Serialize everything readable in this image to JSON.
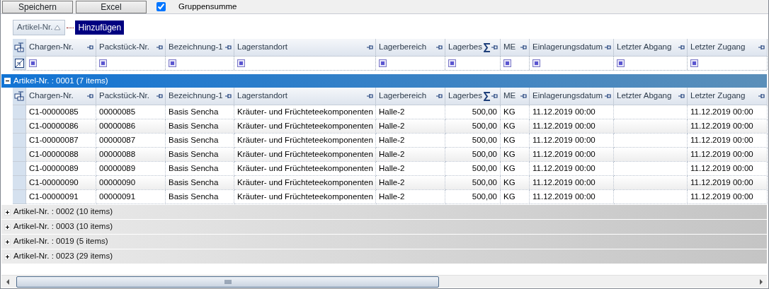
{
  "toolbar": {
    "buttons": [
      "Speichern",
      "Excel"
    ],
    "checkbox": {
      "label": "Gruppensumme",
      "checked": true
    }
  },
  "group_panel": {
    "group_by": {
      "label": "Artikel-Nr.",
      "ascending": true
    },
    "add_button": "Hinzufügen"
  },
  "columns": [
    {
      "label": "Chargen-Nr.",
      "summed": false,
      "kind": "text"
    },
    {
      "label": "Packstück-Nr.",
      "summed": false,
      "kind": "text"
    },
    {
      "label": "Bezeichnung-1",
      "summed": false,
      "kind": "text"
    },
    {
      "label": "Lagerstandort",
      "summed": false,
      "kind": "text"
    },
    {
      "label": "Lagerbereich",
      "summed": false,
      "kind": "text"
    },
    {
      "label": "Lagerbes",
      "summed": true,
      "kind": "number"
    },
    {
      "label": "ME",
      "summed": false,
      "kind": "text"
    },
    {
      "label": "Einlagerungsdatum",
      "summed": false,
      "kind": "text"
    },
    {
      "label": "Letzter Abgang",
      "summed": false,
      "kind": "text"
    },
    {
      "label": "Letzter Zugang",
      "summed": false,
      "kind": "text"
    }
  ],
  "groups": [
    {
      "label": "Artikel-Nr. : 0001 (7 items)",
      "expanded": true,
      "columns": [
        "Chargen-Nr.",
        "Packstück-Nr.",
        "Bezeichnung-1",
        "Lagerstandort",
        "Lagerbereich",
        "Lagerbes",
        "ME",
        "Einlagerungsdatum",
        "Letzter Abgang",
        "Letzter Zugang"
      ],
      "rows": [
        [
          "C1-00000085",
          "00000085",
          "Basis Sencha",
          "Kräuter- und Früchteteekomponenten",
          "Halle-2",
          "500,00",
          "KG",
          "11.12.2019 00:00",
          "",
          "11.12.2019 00:00"
        ],
        [
          "C1-00000086",
          "00000086",
          "Basis Sencha",
          "Kräuter- und Früchteteekomponenten",
          "Halle-2",
          "500,00",
          "KG",
          "11.12.2019 00:00",
          "",
          "11.12.2019 00:00"
        ],
        [
          "C1-00000087",
          "00000087",
          "Basis Sencha",
          "Kräuter- und Früchteteekomponenten",
          "Halle-2",
          "500,00",
          "KG",
          "11.12.2019 00:00",
          "",
          "11.12.2019 00:00"
        ],
        [
          "C1-00000088",
          "00000088",
          "Basis Sencha",
          "Kräuter- und Früchteteekomponenten",
          "Halle-2",
          "500,00",
          "KG",
          "11.12.2019 00:00",
          "",
          "11.12.2019 00:00"
        ],
        [
          "C1-00000089",
          "00000089",
          "Basis Sencha",
          "Kräuter- und Früchteteekomponenten",
          "Halle-2",
          "500,00",
          "KG",
          "11.12.2019 00:00",
          "",
          "11.12.2019 00:00"
        ],
        [
          "C1-00000090",
          "00000090",
          "Basis Sencha",
          "Kräuter- und Früchteteekomponenten",
          "Halle-2",
          "500,00",
          "KG",
          "11.12.2019 00:00",
          "",
          "11.12.2019 00:00"
        ],
        [
          "C1-00000091",
          "00000091",
          "Basis Sencha",
          "Kräuter- und Früchteteekomponenten",
          "Halle-2",
          "500,00",
          "KG",
          "11.12.2019 00:00",
          "",
          "11.12.2019 00:00"
        ]
      ]
    },
    {
      "label": "Artikel-Nr. : 0002 (10 items)",
      "expanded": false
    },
    {
      "label": "Artikel-Nr. : 0003 (10 items)",
      "expanded": false
    },
    {
      "label": "Artikel-Nr. : 0019 (5 items)",
      "expanded": false
    },
    {
      "label": "Artikel-Nr. : 0023 (29 items)",
      "expanded": false
    }
  ]
}
